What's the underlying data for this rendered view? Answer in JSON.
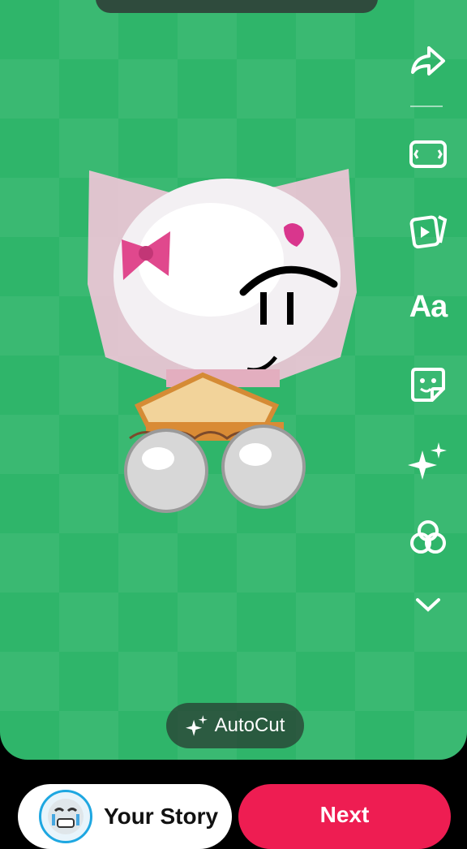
{
  "editor": {
    "toolbar": [
      {
        "name": "share-icon"
      },
      {
        "name": "resize-icon"
      },
      {
        "name": "video-template-icon"
      },
      {
        "name": "text-icon",
        "label": "Aa"
      },
      {
        "name": "sticker-icon"
      },
      {
        "name": "effects-icon"
      },
      {
        "name": "filters-icon"
      },
      {
        "name": "chevron-down-icon"
      }
    ],
    "autocut_label": "AutoCut"
  },
  "bottom": {
    "your_story_label": "Your Story",
    "next_label": "Next"
  },
  "colors": {
    "canvas_bg": "#2fb56a",
    "next_button": "#ee1d52",
    "story_ring": "#1ea7e1"
  }
}
